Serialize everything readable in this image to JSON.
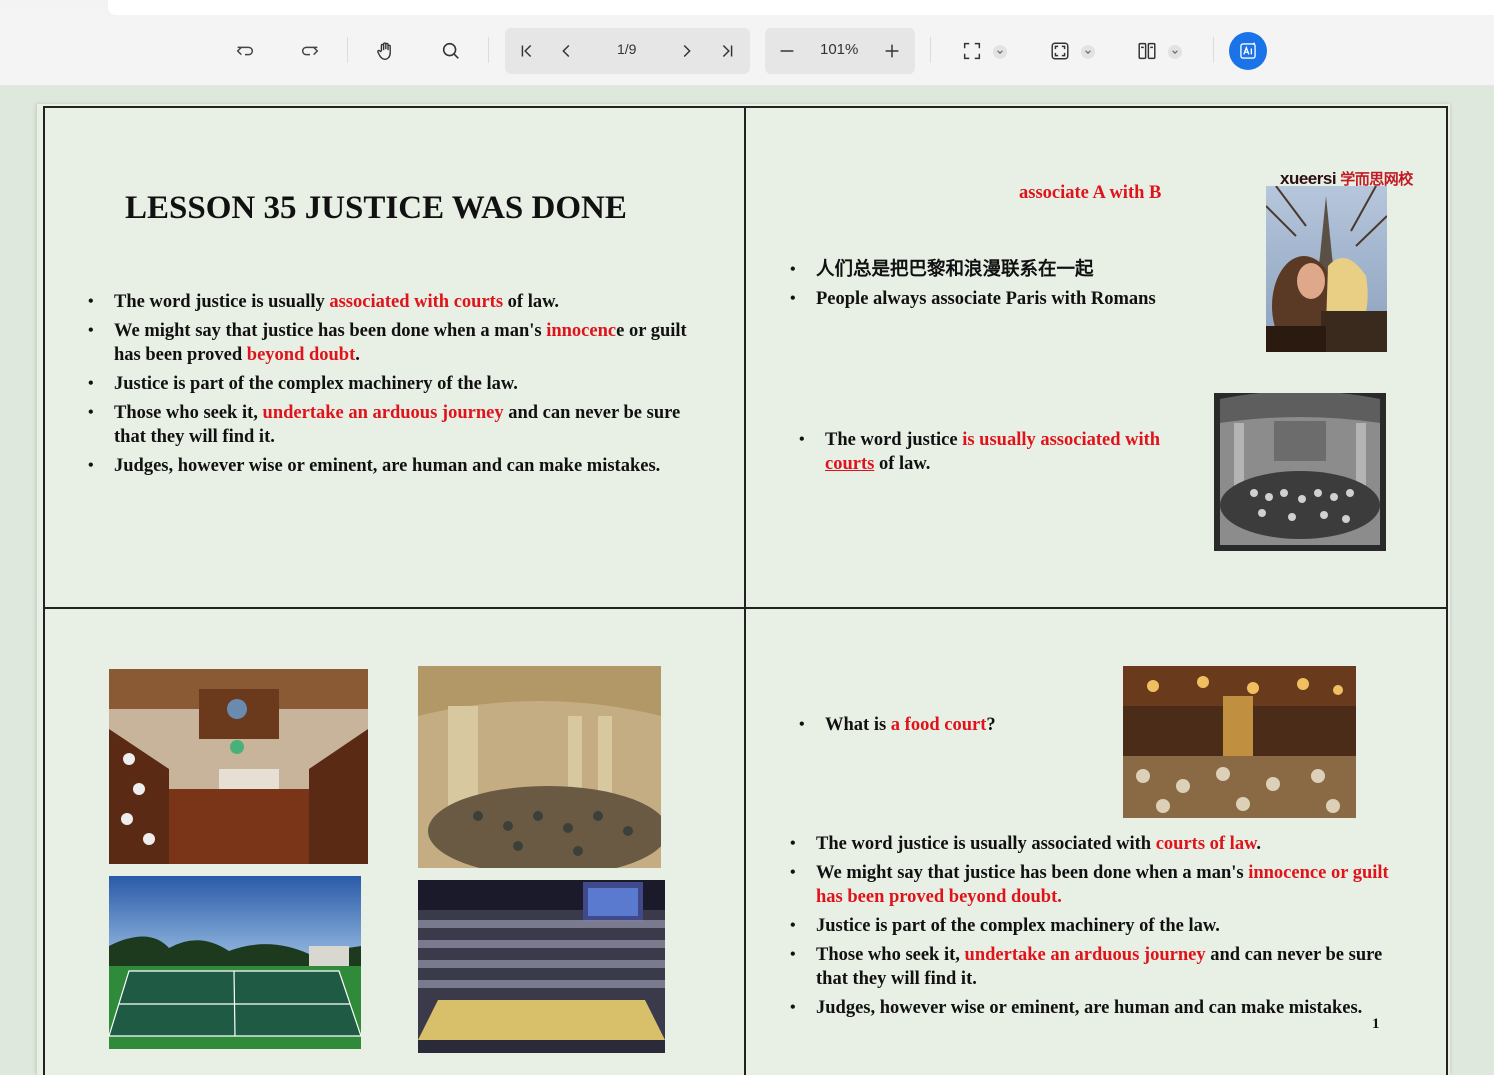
{
  "toolbar": {
    "page_indicator": "1/9",
    "zoom_level": "101%",
    "accent_color": "#1a73e8",
    "icons": [
      "undo-icon",
      "redo-icon",
      "hand-tool-icon",
      "search-icon",
      "first-page-icon",
      "prev-page-icon",
      "next-page-icon",
      "last-page-icon",
      "zoom-out-icon",
      "zoom-in-icon",
      "fullscreen-icon",
      "fit-page-icon",
      "two-page-view-icon",
      "ai-assistant-icon"
    ]
  },
  "document": {
    "lesson_title": "LESSON 35  JUSTICE WAS DONE",
    "left_bullets": [
      {
        "segments": [
          {
            "t": "The word justice is usually ",
            "red": false
          },
          {
            "t": "associated with courts",
            "red": true
          },
          {
            "t": " of law.",
            "red": false
          }
        ]
      },
      {
        "segments": [
          {
            "t": "We might say that justice has been done when a man's ",
            "red": false
          },
          {
            "t": "innocenc",
            "red": true
          },
          {
            "t": "e or guilt has been proved ",
            "red": false
          },
          {
            "t": "beyond doubt",
            "red": true
          },
          {
            "t": ".",
            "red": false
          }
        ]
      },
      {
        "segments": [
          {
            "t": "Justice is part of the complex machinery of the law.",
            "red": false
          }
        ]
      },
      {
        "segments": [
          {
            "t": "Those who seek it, ",
            "red": false
          },
          {
            "t": "undertake an arduous journey",
            "red": true
          },
          {
            "t": " and can never be sure that they will find it.",
            "red": false
          }
        ]
      },
      {
        "segments": [
          {
            "t": "Judges, however wise or eminent, are human and can make mistakes.",
            "red": false
          }
        ]
      }
    ],
    "associate_heading": "associate A with B",
    "logo_latin": "xueersi",
    "logo_chinese": "学而思网校",
    "associate_bullets": [
      {
        "segments": [
          {
            "t": "人们总是把巴黎和浪漫联系在一起",
            "red": false
          }
        ]
      },
      {
        "segments": [
          {
            "t": "People always associate Paris with Romans",
            "red": false
          }
        ]
      }
    ],
    "justice_bullet": [
      {
        "segments": [
          {
            "t": "The word justice ",
            "red": false
          },
          {
            "t": "is usually associated with ",
            "red": true
          },
          {
            "t": "courts",
            "red": true,
            "underline": true
          },
          {
            "t": " of law.",
            "red": false
          }
        ]
      }
    ],
    "food_court_bullet": [
      {
        "segments": [
          {
            "t": "What is ",
            "red": false
          },
          {
            "t": "a food court",
            "red": true
          },
          {
            "t": "?",
            "red": false
          }
        ]
      }
    ],
    "right_bullets": [
      {
        "segments": [
          {
            "t": "The word justice is usually associated with ",
            "red": false
          },
          {
            "t": "courts of law",
            "red": true
          },
          {
            "t": ".",
            "red": false
          }
        ]
      },
      {
        "segments": [
          {
            "t": "We might say that justice has been done when a man's ",
            "red": false
          },
          {
            "t": "innocence or guilt has been proved beyond doubt.",
            "red": true
          }
        ]
      },
      {
        "segments": [
          {
            "t": "Justice is part of the complex machinery of the law.",
            "red": false
          }
        ]
      },
      {
        "segments": [
          {
            "t": "Those who seek it, ",
            "red": false
          },
          {
            "t": "undertake an arduous journey",
            "red": true
          },
          {
            "t": " and can never be sure that they will find it.",
            "red": false
          }
        ]
      },
      {
        "segments": [
          {
            "t": "Judges, however wise or eminent, are human and can make mistakes.",
            "red": false
          }
        ]
      }
    ],
    "page_number": "1",
    "accent_red": "#e0131b"
  }
}
